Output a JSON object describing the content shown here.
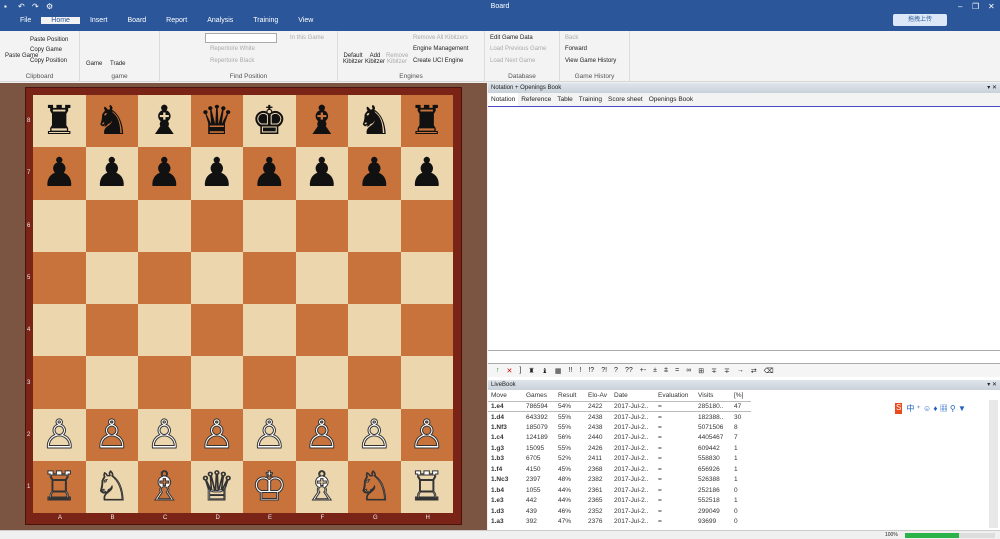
{
  "window": {
    "title": "Board",
    "upload_label": "拖拽上传"
  },
  "menu_tabs": [
    "File",
    "Home",
    "Insert",
    "Board",
    "Report",
    "Analysis",
    "Training",
    "View"
  ],
  "ribbon": {
    "clipboard": {
      "label": "Clipboard",
      "items": [
        "Paste Game",
        "Paste Position",
        "Copy Game",
        "Copy Position"
      ]
    },
    "game": {
      "label": "game",
      "items": [
        "Game",
        "Trade"
      ]
    },
    "find": {
      "label": "Find Position",
      "in_this_game": "In this Game",
      "rep_white": "Repertoire White",
      "rep_black": "Repertoire Black"
    },
    "engines": {
      "label": "Engines",
      "default": "Default Kibitzer",
      "add": "Add Kibitzer",
      "remove": "Remove Kibitzer",
      "remove_all": "Remove All Kibitzers",
      "mgmt": "Engine Management",
      "uci": "Create UCI Engine"
    },
    "database": {
      "label": "Database",
      "edit": "Edit Game Data",
      "prev": "Load Previous Game",
      "next": "Load Next Game"
    },
    "history": {
      "label": "Game History",
      "back": "Back",
      "forward": "Forward",
      "view": "View Game History"
    }
  },
  "board": {
    "files": [
      "A",
      "B",
      "C",
      "D",
      "E",
      "F",
      "G",
      "H"
    ],
    "ranks": [
      "8",
      "7",
      "6",
      "5",
      "4",
      "3",
      "2",
      "1"
    ],
    "position": [
      [
        "♜",
        "♞",
        "♝",
        "♛",
        "♚",
        "♝",
        "♞",
        "♜"
      ],
      [
        "♟",
        "♟",
        "♟",
        "♟",
        "♟",
        "♟",
        "♟",
        "♟"
      ],
      [
        "",
        "",
        "",
        "",
        "",
        "",
        "",
        ""
      ],
      [
        "",
        "",
        "",
        "",
        "",
        "",
        "",
        ""
      ],
      [
        "",
        "",
        "",
        "",
        "",
        "",
        "",
        ""
      ],
      [
        "",
        "",
        "",
        "",
        "",
        "",
        "",
        ""
      ],
      [
        "♙",
        "♙",
        "♙",
        "♙",
        "♙",
        "♙",
        "♙",
        "♙"
      ],
      [
        "♖",
        "♘",
        "♗",
        "♕",
        "♔",
        "♗",
        "♘",
        "♖"
      ]
    ]
  },
  "notation": {
    "header": "Notation + Openings Book",
    "tabs": [
      "Notation",
      "Reference",
      "Table",
      "Training",
      "Score sheet",
      "Openings Book"
    ]
  },
  "toolbar": [
    "↑",
    "✕",
    "]",
    "♜",
    "♝",
    "▦",
    "!!",
    "!",
    "!?",
    "?!",
    "?",
    "??",
    "+-",
    "±",
    "⩲",
    "=",
    "∞",
    "⊞",
    "∓",
    "∓",
    "→",
    "⇄",
    "⌫"
  ],
  "livebook": {
    "header": "LiveBook",
    "columns": [
      "Move",
      "Games",
      "Result",
      "Elo-Av",
      "Date",
      "Evaluation",
      "Visits",
      "[%]"
    ],
    "rows": [
      [
        "1.e4",
        "786594",
        "54%",
        "2422",
        "2017-Jul-2..",
        "=",
        "285180..",
        "47"
      ],
      [
        "1.d4",
        "643392",
        "55%",
        "2438",
        "2017-Jul-2..",
        "=",
        "182388..",
        "30"
      ],
      [
        "1.Nf3",
        "185079",
        "55%",
        "2438",
        "2017-Jul-2..",
        "=",
        "5071506",
        "8"
      ],
      [
        "1.c4",
        "124189",
        "56%",
        "2440",
        "2017-Jul-2..",
        "=",
        "4405467",
        "7"
      ],
      [
        "1.g3",
        "15095",
        "55%",
        "2426",
        "2017-Jul-2..",
        "=",
        "609442",
        "1"
      ],
      [
        "1.b3",
        "6705",
        "52%",
        "2411",
        "2017-Jul-2..",
        "=",
        "558830",
        "1"
      ],
      [
        "1.f4",
        "4150",
        "45%",
        "2368",
        "2017-Jul-2..",
        "=",
        "656926",
        "1"
      ],
      [
        "1.Nc3",
        "2397",
        "48%",
        "2382",
        "2017-Jul-2..",
        "=",
        "526388",
        "1"
      ],
      [
        "1.b4",
        "1055",
        "44%",
        "2361",
        "2017-Jul-2..",
        "=",
        "252186",
        "0"
      ],
      [
        "1.e3",
        "442",
        "44%",
        "2365",
        "2017-Jul-2..",
        "=",
        "552518",
        "1"
      ],
      [
        "1.d3",
        "439",
        "46%",
        "2352",
        "2017-Jul-2..",
        "=",
        "299049",
        "0"
      ],
      [
        "1.a3",
        "392",
        "47%",
        "2376",
        "2017-Jul-2..",
        "=",
        "93699",
        "0"
      ]
    ]
  },
  "status": {
    "zoom": "100%",
    "progress": 0.6
  }
}
